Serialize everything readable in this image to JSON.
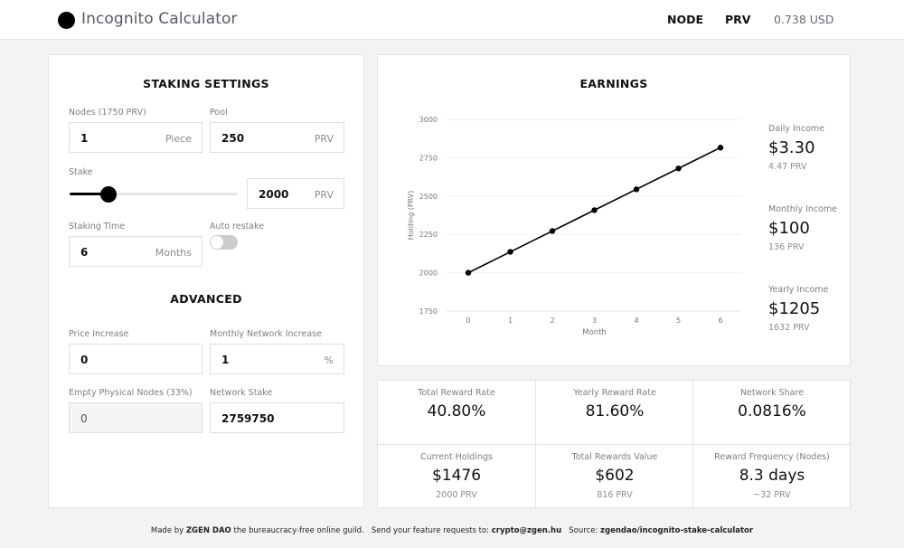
{
  "header": {
    "title": "Incognito Calculator",
    "nav_node": "NODE",
    "nav_prv": "PRV",
    "price": "0.738 USD"
  },
  "settings": {
    "title": "STAKING SETTINGS",
    "nodes": {
      "label": "Nodes (1750 PRV)",
      "value": "1",
      "unit": "Piece"
    },
    "pool": {
      "label": "Pool",
      "value": "250",
      "unit": "PRV"
    },
    "stake": {
      "label": "Stake",
      "value": "2000",
      "unit": "PRV",
      "slider_fraction": 0.23
    },
    "staking_time": {
      "label": "Staking Time",
      "value": "6",
      "unit": "Months"
    },
    "auto_restake": {
      "label": "Auto restake",
      "enabled": false
    },
    "advanced_title": "ADVANCED",
    "price_increase": {
      "label": "Price Increase",
      "value": "0"
    },
    "monthly_network_increase": {
      "label": "Monthly Network Increase",
      "value": "1",
      "unit": "%"
    },
    "empty_physical_nodes": {
      "label": "Empty Physical Nodes (33%)",
      "value": "0"
    },
    "network_stake": {
      "label": "Network Stake",
      "value": "2759750"
    }
  },
  "earnings": {
    "title": "EARNINGS",
    "daily": {
      "label": "Daily Income",
      "usd": "$3.30",
      "prv": "4.47 PRV"
    },
    "monthly": {
      "label": "Monthly Income",
      "usd": "$100",
      "prv": "136 PRV"
    },
    "yearly": {
      "label": "Yearly Income",
      "usd": "$1205",
      "prv": "1632 PRV"
    }
  },
  "chart_data": {
    "type": "line",
    "title": "",
    "xlabel": "Month",
    "ylabel": "Holding (PRV)",
    "x": [
      0,
      1,
      2,
      3,
      4,
      5,
      6
    ],
    "series": [
      {
        "name": "Holding",
        "values": [
          2000,
          2136,
          2272,
          2408,
          2544,
          2680,
          2816
        ],
        "color": "#000000"
      }
    ],
    "ylim": [
      1750,
      3000
    ],
    "yticks": [
      1750,
      2000,
      2250,
      2500,
      2750,
      3000
    ],
    "xticks": [
      "0",
      "1",
      "2",
      "3",
      "4",
      "5",
      "6"
    ],
    "grid": true,
    "legend": "none"
  },
  "stats": [
    {
      "label": "Total Reward Rate",
      "value": "40.80%",
      "sub": ""
    },
    {
      "label": "Yearly Reward Rate",
      "value": "81.60%",
      "sub": ""
    },
    {
      "label": "Network Share",
      "value": "0.0816%",
      "sub": ""
    },
    {
      "label": "Current Holdings",
      "value": "$1476",
      "sub": "2000 PRV"
    },
    {
      "label": "Total Rewards Value",
      "value": "$602",
      "sub": "816 PRV"
    },
    {
      "label": "Reward Frequency (Nodes)",
      "value": "8.3 days",
      "sub": "~32 PRV"
    }
  ],
  "footer": {
    "made_by": "Made by",
    "org": "ZGEN DAO",
    "tagline": "the bureaucracy-free online guild.",
    "requests": "Send your feature requests to:",
    "email": "crypto@zgen.hu",
    "source_label": "Source:",
    "source": "zgendao/incognito-stake-calculator"
  }
}
